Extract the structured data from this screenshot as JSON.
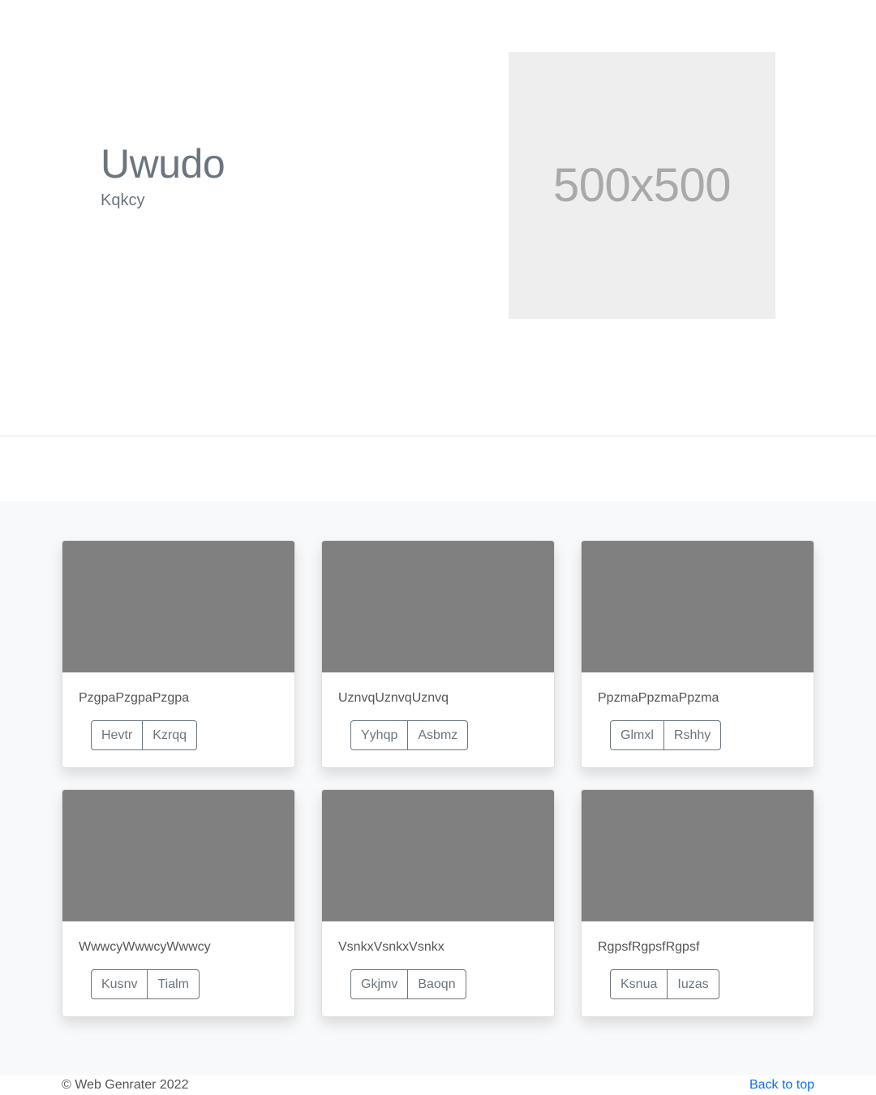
{
  "hero": {
    "title": "Uwudo",
    "subtitle": "Kqkcy",
    "image_placeholder": "500x500"
  },
  "cards": [
    {
      "text": "PzgpaPzgpaPzgpa",
      "buttons": [
        "Hevtr",
        "Kzrqq"
      ]
    },
    {
      "text": "UznvqUznvqUznvq",
      "buttons": [
        "Yyhqp",
        "Asbmz"
      ]
    },
    {
      "text": "PpzmaPpzmaPpzma",
      "buttons": [
        "Glmxl",
        "Rshhy"
      ]
    },
    {
      "text": "WwwcyWwwcyWwwcy",
      "buttons": [
        "Kusnv",
        "Tialm"
      ]
    },
    {
      "text": "VsnkxVsnkxVsnkx",
      "buttons": [
        "Gkjmv",
        "Baoqn"
      ]
    },
    {
      "text": "RgpsfRgpsfRgpsf",
      "buttons": [
        "Ksnua",
        "Iuzas"
      ]
    }
  ],
  "footer": {
    "copyright": "© Web Genrater 2022",
    "back_to_top": "Back to top"
  },
  "colors": {
    "card_image": "#808080",
    "album_bg": "#f8f9fa",
    "link": "#0d6efd",
    "muted": "#6c757d"
  }
}
